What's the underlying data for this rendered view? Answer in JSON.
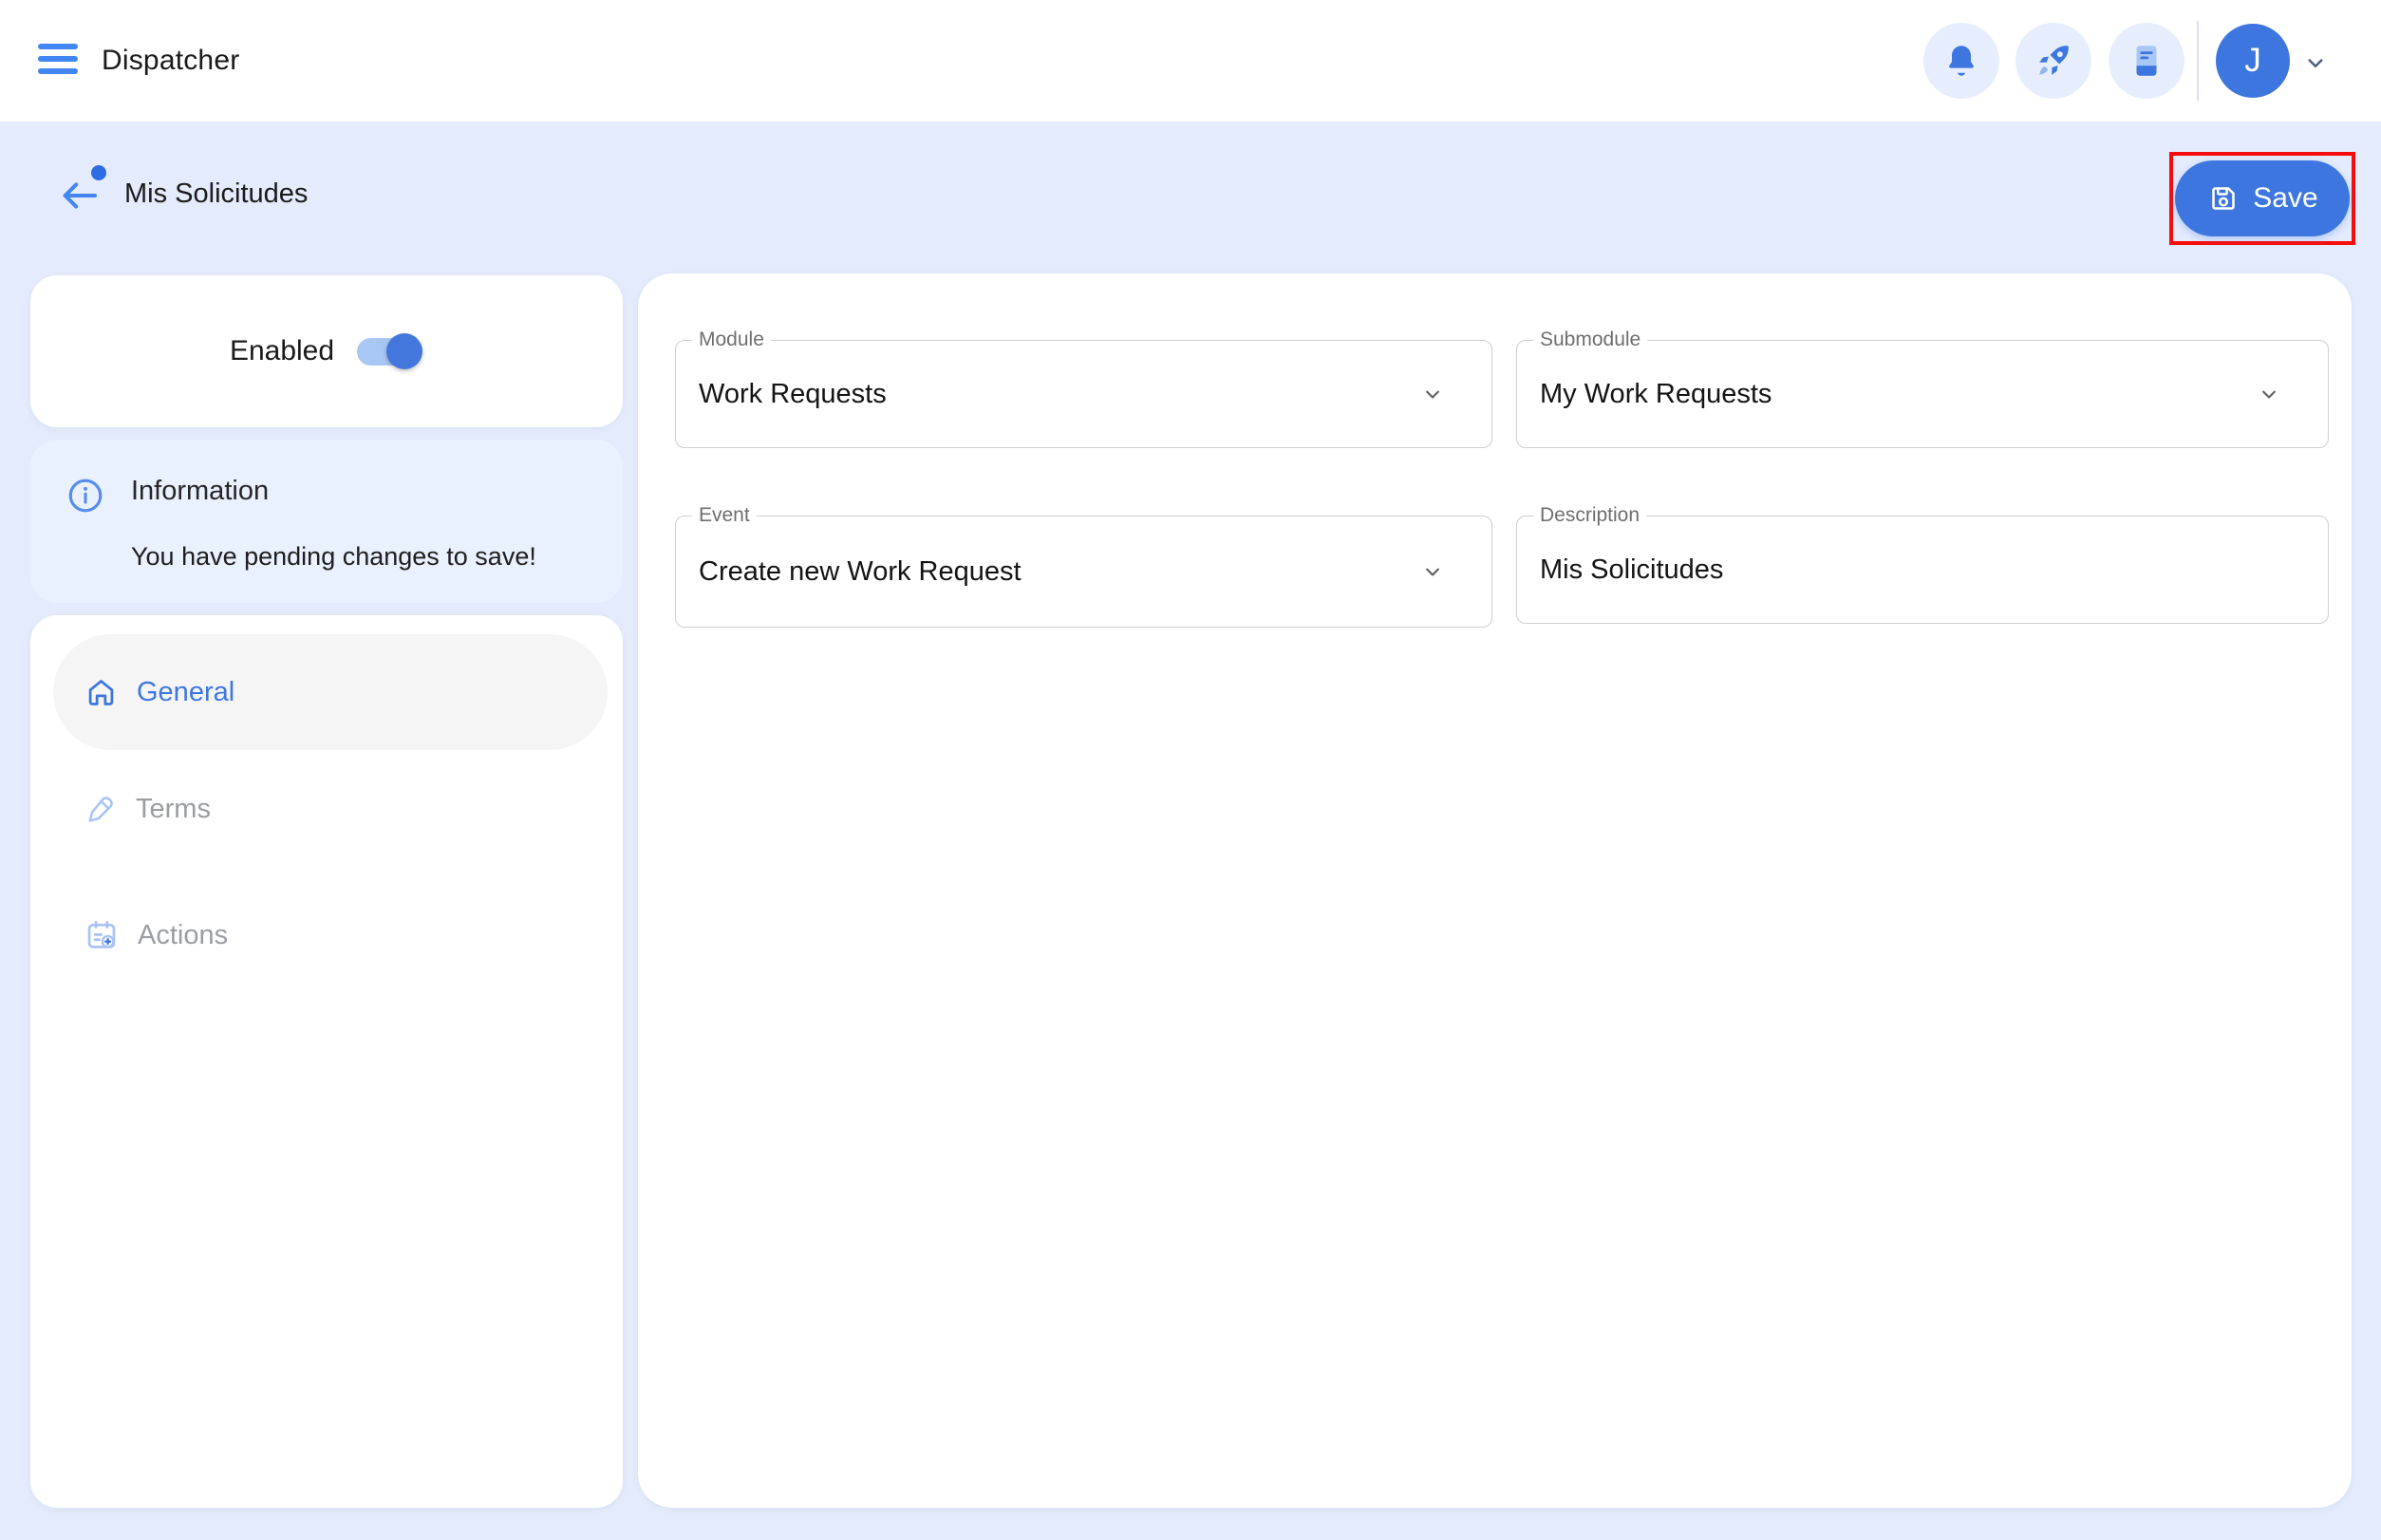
{
  "header": {
    "title": "Dispatcher",
    "avatar_initial": "J"
  },
  "page": {
    "title": "Mis Solicitudes",
    "save_label": "Save"
  },
  "sidebar": {
    "enabled_label": "Enabled",
    "info": {
      "title": "Information",
      "message": "You have pending changes to save!"
    },
    "nav": [
      {
        "label": "General",
        "icon": "home-icon",
        "active": true
      },
      {
        "label": "Terms",
        "icon": "pencil-icon",
        "active": false
      },
      {
        "label": "Actions",
        "icon": "calendar-plus-icon",
        "active": false
      }
    ]
  },
  "form": {
    "module": {
      "label": "Module",
      "value": "Work Requests"
    },
    "submodule": {
      "label": "Submodule",
      "value": "My Work Requests"
    },
    "event": {
      "label": "Event",
      "value": "Create new Work Request"
    },
    "description": {
      "label": "Description",
      "value": "Mis Solicitudes"
    }
  },
  "icons": [
    "menu-icon",
    "bell-icon",
    "rocket-icon",
    "notebook-icon",
    "user-menu-chevron-icon",
    "back-arrow-icon",
    "save-icon",
    "info-icon",
    "home-icon",
    "pencil-icon",
    "calendar-plus-icon",
    "chevron-down-icon"
  ],
  "colors": {
    "accent": "#3E76E0",
    "accent_bright": "#4285F4",
    "page_bg": "#E3EBFC",
    "info_card_bg": "#E9F0FE",
    "toggle_track": "#A9C7F4",
    "inactive_nav": "#9A9DA1",
    "annotation_red": "#F50D0D"
  }
}
